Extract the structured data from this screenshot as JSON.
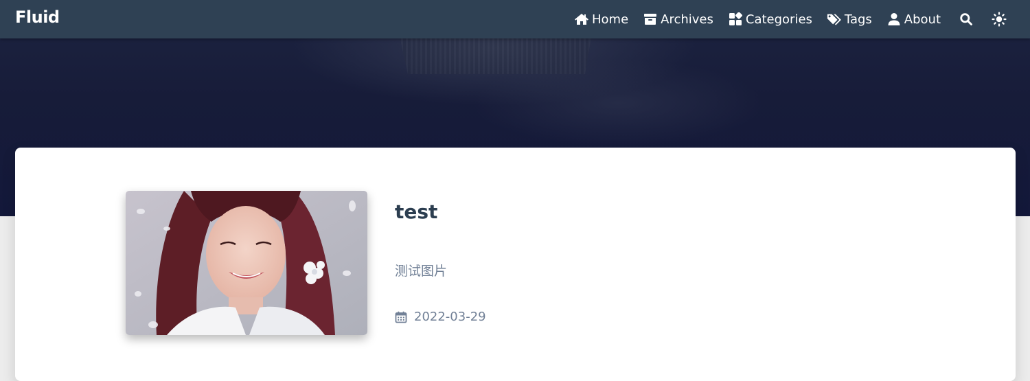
{
  "site": {
    "brand": "Fluid"
  },
  "nav": {
    "items": [
      {
        "label": "Home",
        "icon": "home-icon"
      },
      {
        "label": "Archives",
        "icon": "archive-icon"
      },
      {
        "label": "Categories",
        "icon": "categories-icon"
      },
      {
        "label": "Tags",
        "icon": "tags-icon"
      },
      {
        "label": "About",
        "icon": "user-icon"
      }
    ],
    "search_icon": "search-icon",
    "theme_icon": "sun-icon"
  },
  "post": {
    "title": "test",
    "excerpt": "测试图片",
    "date": "2022-03-29",
    "date_icon": "calendar-icon"
  },
  "colors": {
    "navbar": "#2f4154",
    "title": "#2c3e50",
    "muted": "#718096"
  }
}
